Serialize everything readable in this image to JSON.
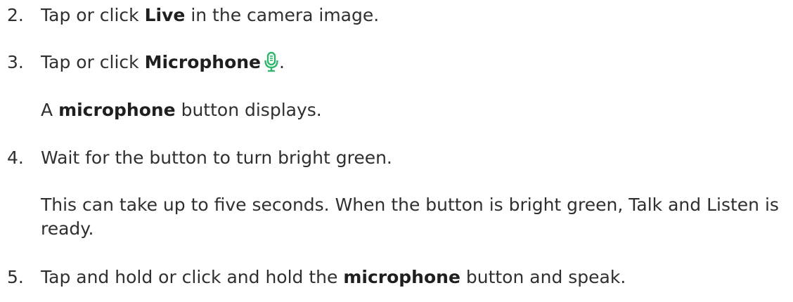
{
  "steps": [
    {
      "number": "2.",
      "before": "Tap or click ",
      "bold": "Live",
      "after": " in the camera image."
    },
    {
      "number": "3.",
      "before": "Tap or click ",
      "bold": "Microphone",
      "after": ".",
      "icon": "microphone-icon",
      "icon_color": "#2eb66a",
      "note_before": "A ",
      "note_bold": "microphone",
      "note_after": " button displays."
    },
    {
      "number": "4.",
      "text": "Wait for the button to turn bright green.",
      "note": "This can take up to five seconds. When the button is bright green, Talk and Listen is ready."
    },
    {
      "number": "5.",
      "before": "Tap and hold or click and hold the ",
      "bold": "microphone",
      "after": " button and speak."
    }
  ]
}
